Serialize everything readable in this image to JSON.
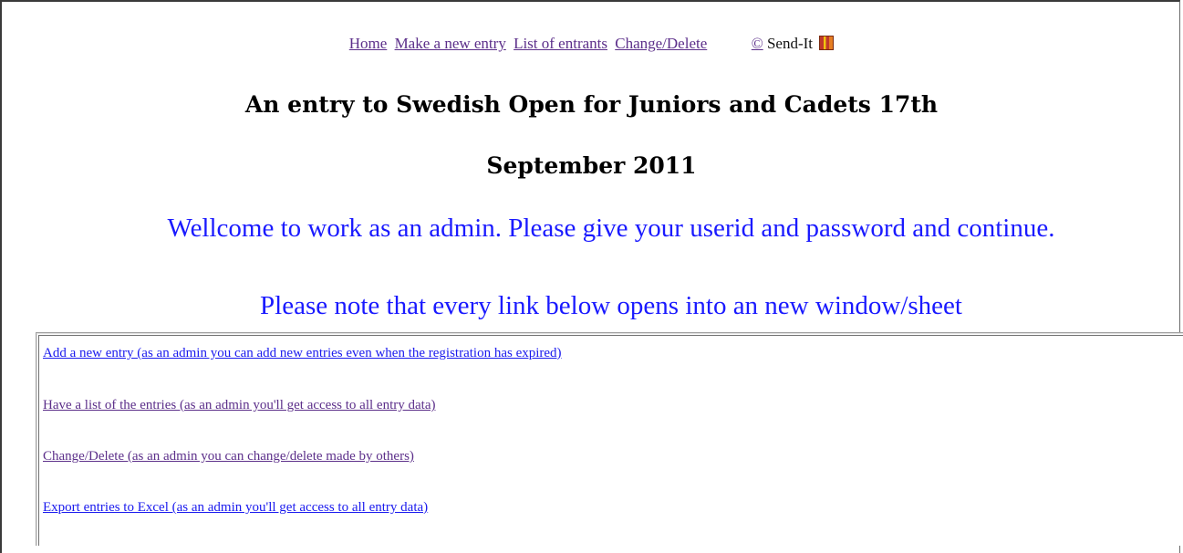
{
  "nav": {
    "home": "Home",
    "new_entry": "Make a new entry",
    "list": "List of entrants",
    "change_delete": "Change/Delete",
    "copyright_symbol": "©",
    "copyright_text": " Send-It",
    "flag_icon": "flag-logo-icon"
  },
  "title": {
    "line1": "An entry to Swedish Open for Juniors and Cadets 17th",
    "line2": "September 2011"
  },
  "welcome": "Wellcome to work as an admin. Please give your userid and password and continue.",
  "note": "Please note that every link below opens into an new window/sheet",
  "admin_links": [
    {
      "label": "Add a new entry (as an admin you can add new entries even when the registration has expired)",
      "color": "#1a1aee"
    },
    {
      "label": "Have a list of the entries (as an admin you'll get access to all entry data)",
      "color": "#5c2f8a"
    },
    {
      "label": "Change/Delete (as an admin you can change/delete made by others)",
      "color": "#5c2f8a"
    },
    {
      "label": "Export entries to Excel (as an admin you'll get access to all entry data)",
      "color": "#1a1aee"
    }
  ],
  "colors": {
    "heading_blue": "#1a1aff",
    "visited_link": "#5c2f8a",
    "link": "#1a1aee"
  }
}
